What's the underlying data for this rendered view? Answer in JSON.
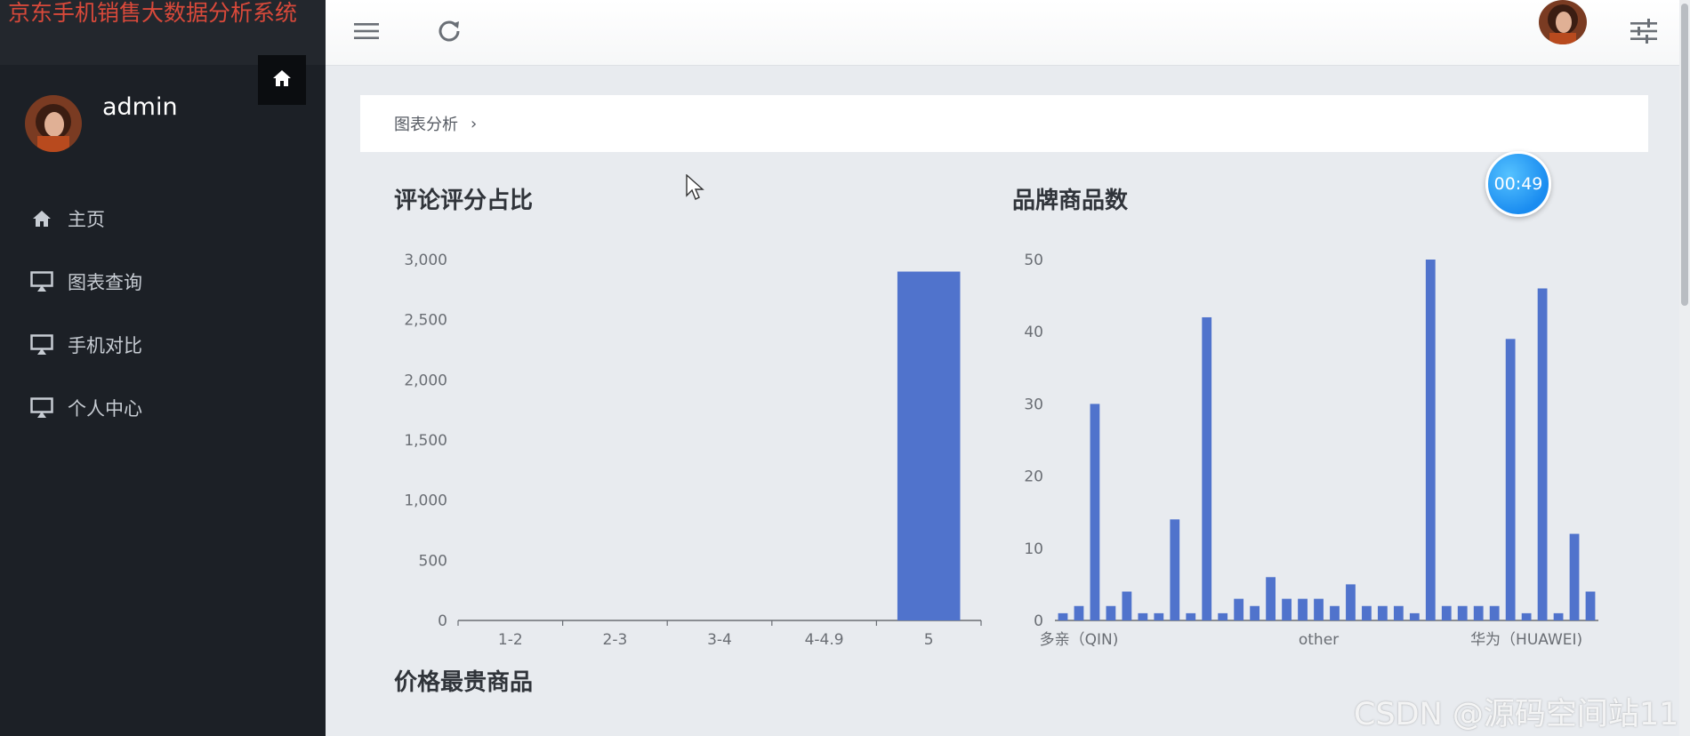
{
  "app": {
    "title": "京东手机销售大数据分析系统",
    "user": "admin"
  },
  "sidebar": {
    "items": [
      {
        "label": "主页",
        "icon": "home-icon"
      },
      {
        "label": "图表查询",
        "icon": "monitor-icon"
      },
      {
        "label": "手机对比",
        "icon": "monitor-icon"
      },
      {
        "label": "个人中心",
        "icon": "monitor-icon"
      }
    ]
  },
  "breadcrumb": {
    "items": [
      "图表分析"
    ],
    "separator": "›"
  },
  "sections": {
    "rating_title": "评论评分占比",
    "brand_title": "品牌商品数",
    "price_title": "价格最贵商品"
  },
  "timer": "00:49",
  "watermark": "CSDN @源码空间站11",
  "colors": {
    "bar": "#5073cc",
    "sidebar": "#1c2026",
    "brand_title": "#d9493a",
    "timer": "#1a8cf0"
  },
  "chart_data": [
    {
      "type": "bar",
      "title": "评论评分占比",
      "categories": [
        "1-2",
        "2-3",
        "3-4",
        "4-4.9",
        "5"
      ],
      "values": [
        0,
        0,
        0,
        0,
        2900
      ],
      "ylim": [
        0,
        3000
      ],
      "yticks": [
        0,
        500,
        1000,
        1500,
        2000,
        2500,
        3000
      ],
      "ytick_labels": [
        "0",
        "500",
        "1,000",
        "1,500",
        "2,000",
        "2,500",
        "3,000"
      ],
      "grid": false
    },
    {
      "type": "bar",
      "title": "品牌商品数",
      "visible_category_labels": [
        "多亲（QIN)",
        "other",
        "华为（HUAWEI)"
      ],
      "values": [
        1,
        2,
        30,
        2,
        4,
        1,
        1,
        14,
        1,
        42,
        1,
        3,
        2,
        6,
        3,
        3,
        3,
        2,
        5,
        2,
        2,
        2,
        1,
        50,
        2,
        2,
        2,
        2,
        39,
        1,
        46,
        1,
        12,
        4
      ],
      "ylim": [
        0,
        50
      ],
      "yticks": [
        0,
        10,
        20,
        30,
        40,
        50
      ],
      "ytick_labels": [
        "0",
        "10",
        "20",
        "30",
        "40",
        "50"
      ],
      "grid": false
    }
  ]
}
